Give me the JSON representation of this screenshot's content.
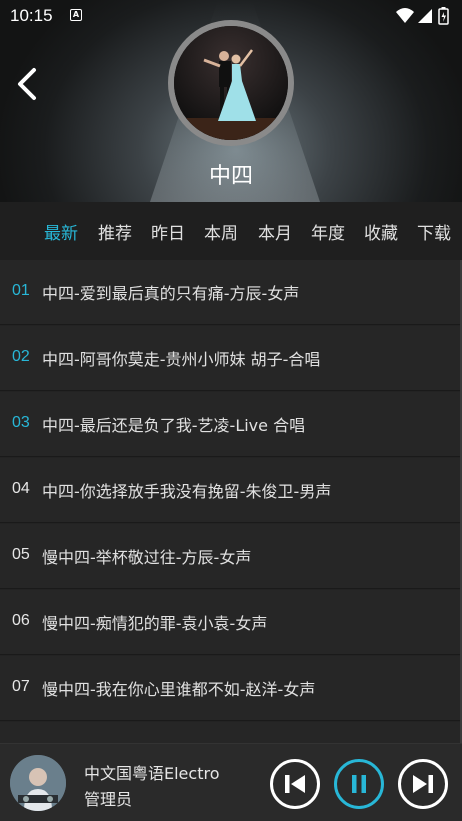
{
  "status": {
    "time": "10:15"
  },
  "header": {
    "title": "中四"
  },
  "tabs": [
    {
      "label": "最新",
      "active": true
    },
    {
      "label": "推荐",
      "active": false
    },
    {
      "label": "昨日",
      "active": false
    },
    {
      "label": "本周",
      "active": false
    },
    {
      "label": "本月",
      "active": false
    },
    {
      "label": "年度",
      "active": false
    },
    {
      "label": "收藏",
      "active": false
    },
    {
      "label": "下载",
      "active": false
    }
  ],
  "songs": [
    {
      "num": "01",
      "name": "中四-爱到最后真的只有痛-方辰-女声",
      "highlight": true
    },
    {
      "num": "02",
      "name": "中四-阿哥你莫走-贵州小师妹 胡子-合唱",
      "highlight": true
    },
    {
      "num": "03",
      "name": "中四-最后还是负了我-艺凌-Live 合唱",
      "highlight": true
    },
    {
      "num": "04",
      "name": "中四-你选择放手我没有挽留-朱俊卫-男声",
      "highlight": false
    },
    {
      "num": "05",
      "name": "慢中四-举杯敬过往-方辰-女声",
      "highlight": false
    },
    {
      "num": "06",
      "name": "慢中四-痴情犯的罪-袁小袁-女声",
      "highlight": false
    },
    {
      "num": "07",
      "name": "慢中四-我在你心里谁都不如-赵洋-女声",
      "highlight": false
    },
    {
      "num": "",
      "name": "",
      "highlight": false
    }
  ],
  "player": {
    "title": "中文国粤语Electro",
    "subtitle": "管理员"
  },
  "colors": {
    "accent": "#28b7d7",
    "background": "#232323"
  }
}
